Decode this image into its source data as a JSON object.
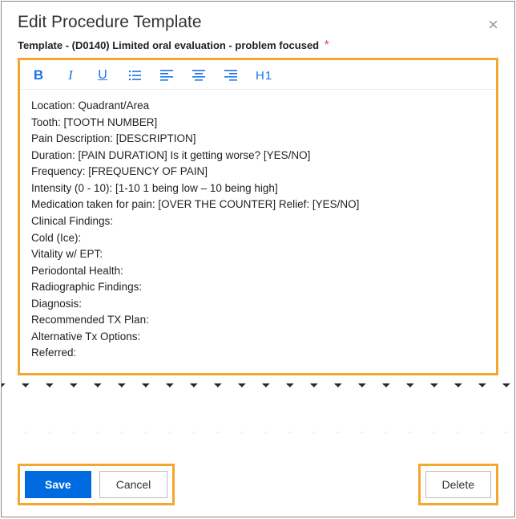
{
  "dialog": {
    "title": "Edit Procedure Template",
    "subtitle": "Template - (D0140) Limited oral evaluation - problem focused",
    "required_mark": "*"
  },
  "toolbar": {
    "bold": "B",
    "italic": "I",
    "underline": "U",
    "h1": "H1"
  },
  "template_body": {
    "l0": "Location: Quadrant/Area",
    "l1": "Tooth: [TOOTH NUMBER]",
    "l2": "Pain Description:  [DESCRIPTION]",
    "l3": "Duration: [PAIN DURATION]           Is it getting worse? [YES/NO]",
    "l4": "Frequency: [FREQUENCY OF PAIN]",
    "l5": "Intensity (0 - 10):  [1-10 1 being low – 10 being high]",
    "l6": "Medication taken for pain:  [OVER THE COUNTER]          Relief:  [YES/NO]",
    "l7": "Clinical Findings:",
    "l8": "Cold (Ice):",
    "l9": "Vitality w/ EPT:",
    "l10": "Periodontal Health:",
    "l11": "Radiographic Findings:",
    "l12": "Diagnosis:",
    "l13": "Recommended TX Plan:",
    "l14": "Alternative Tx Options:",
    "l15": "Referred:"
  },
  "buttons": {
    "save": "Save",
    "cancel": "Cancel",
    "delete": "Delete"
  }
}
